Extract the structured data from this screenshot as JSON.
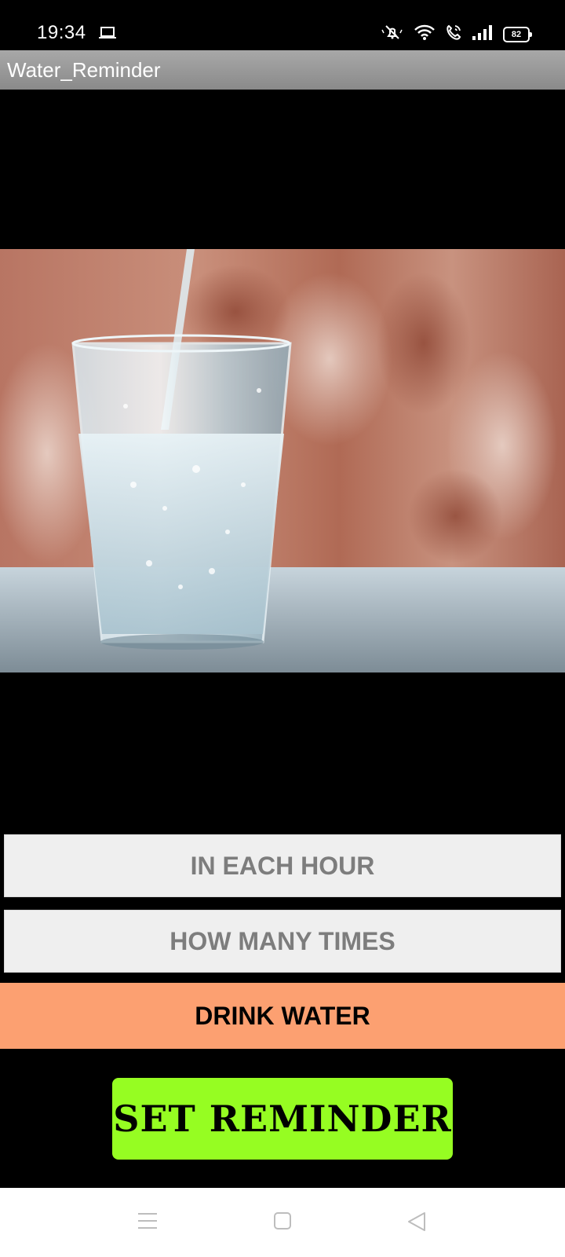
{
  "status_bar": {
    "time": "19:34",
    "battery_level": "82",
    "icons": [
      "laptop-icon",
      "silent-bell-icon",
      "wifi-icon",
      "wifi-call-icon",
      "signal-icon",
      "battery-icon"
    ]
  },
  "action_bar": {
    "title": "Water_Reminder"
  },
  "main": {
    "hour_field_placeholder": "IN EACH HOUR",
    "times_field_placeholder": "HOW MANY TIMES",
    "drink_label": "DRINK WATER",
    "set_reminder_label": "SET REMINDER"
  },
  "nav_bar": {
    "icons": [
      "menu-icon",
      "home-icon",
      "back-icon"
    ]
  },
  "colors": {
    "drink_banner": "#fca071",
    "set_button": "#96fd22",
    "field_bg": "#efefef",
    "field_text": "#7d7d7d"
  }
}
